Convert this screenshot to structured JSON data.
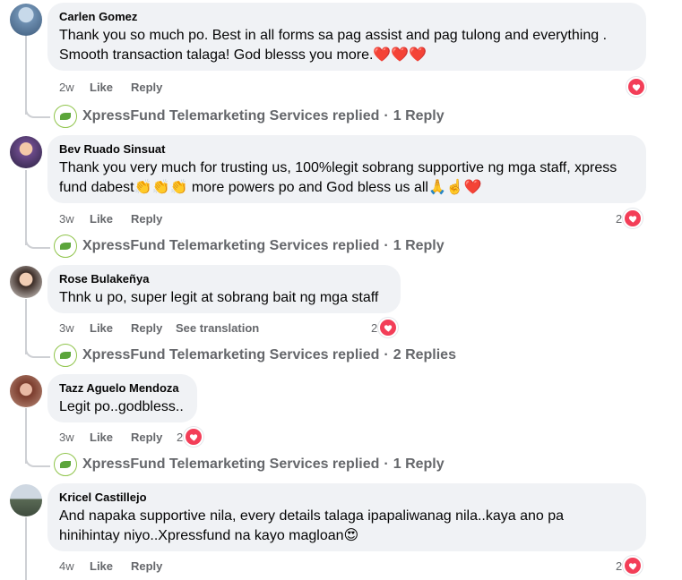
{
  "comments": [
    {
      "author": "Carlen Gomez",
      "line1": "Thank you so much po. Best in all forms sa pag assist and pag tulong and everything .",
      "line2": "Smooth transaction talaga! God blesss you more.❤️❤️❤️",
      "time": "2w",
      "like": "Like",
      "reply": "Reply",
      "reaction_count": "",
      "replies_by": "XpressFund Telemarketing Services replied",
      "replies_count": "1 Reply"
    },
    {
      "author": "Bev Ruado Sinsuat",
      "line1": "Thank you very much for trusting us, 100%legit sobrang supportive ng mga staff, xpress",
      "line2": "fund dabest👏👏👏 more powers po and God bless us all🙏☝️❤️",
      "time": "3w",
      "like": "Like",
      "reply": "Reply",
      "reaction_count": "2",
      "replies_by": "XpressFund Telemarketing Services replied",
      "replies_count": "1 Reply"
    },
    {
      "author": "Rose Bulakeñya",
      "line1": "Thnk u po, super legit at sobrang bait ng mga staff",
      "time": "3w",
      "like": "Like",
      "reply": "Reply",
      "translate": "See translation",
      "reaction_count": "2",
      "replies_by": "XpressFund Telemarketing Services replied",
      "replies_count": "2 Replies"
    },
    {
      "author": "Tazz Aguelo Mendoza",
      "line1": "Legit po..godbless..",
      "time": "3w",
      "like": "Like",
      "reply": "Reply",
      "reaction_count": "2",
      "replies_by": "XpressFund Telemarketing Services replied",
      "replies_count": "1 Reply"
    },
    {
      "author": "Kricel Castillejo",
      "line1": "And napaka supportive nila, every details talaga ipapaliwanag nila..kaya ano pa",
      "line2": "hinihintay niyo..Xpressfund na kayo magloan😍",
      "time": "4w",
      "like": "Like",
      "reply": "Reply",
      "reaction_count": "2"
    }
  ],
  "separator": "·",
  "colors": {
    "bubble": "#f0f2f5",
    "heart": "#f33e58",
    "meta": "#65676b"
  }
}
